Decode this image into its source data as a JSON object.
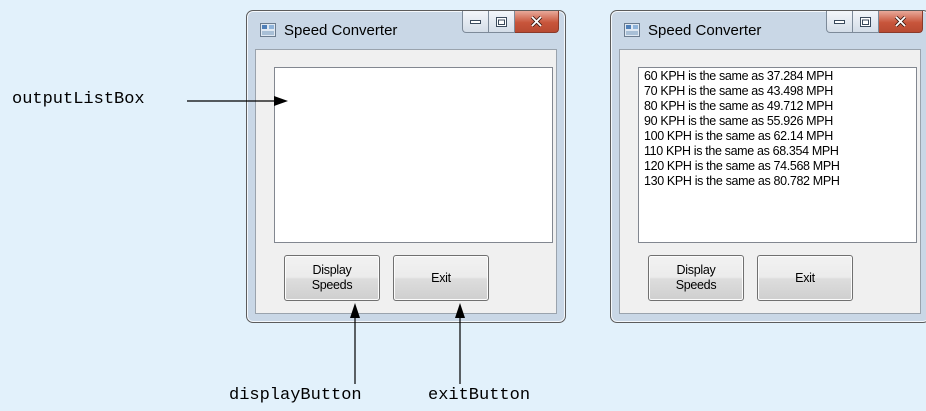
{
  "windows": [
    {
      "title": "Speed Converter",
      "list_items": [],
      "buttons": {
        "display_line1": "Display",
        "display_line2": "Speeds",
        "exit": "Exit"
      }
    },
    {
      "title": "Speed Converter",
      "list_items": [
        "60 KPH is the same as 37.284 MPH",
        "70 KPH is the same as 43.498 MPH",
        "80 KPH is the same as 49.712 MPH",
        "90 KPH is the same as 55.926 MPH",
        "100 KPH is the same as 62.14 MPH",
        "110 KPH is the same as 68.354 MPH",
        "120 KPH is the same as 74.568 MPH",
        "130 KPH is the same as 80.782 MPH"
      ],
      "buttons": {
        "display_line1": "Display",
        "display_line2": "Speeds",
        "exit": "Exit"
      }
    }
  ],
  "callouts": {
    "output_list_box": "outputListBox",
    "display_button": "displayButton",
    "exit_button": "exitButton"
  }
}
